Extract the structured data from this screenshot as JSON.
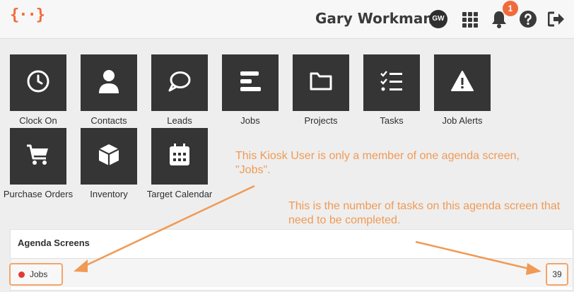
{
  "header": {
    "logo_text": "{··}",
    "user_name": "Gary Workman",
    "avatar_initials": "GW",
    "notification_count": "1",
    "icons": [
      "apps-grid-icon",
      "bell-icon",
      "help-icon",
      "logout-icon"
    ]
  },
  "tiles": [
    {
      "label": "Clock On",
      "icon": "clock-icon"
    },
    {
      "label": "Contacts",
      "icon": "user-icon"
    },
    {
      "label": "Leads",
      "icon": "speech-bubble-icon"
    },
    {
      "label": "Jobs",
      "icon": "bars-icon"
    },
    {
      "label": "Projects",
      "icon": "folder-icon"
    },
    {
      "label": "Tasks",
      "icon": "checklist-icon"
    },
    {
      "label": "Job Alerts",
      "icon": "warning-icon"
    },
    {
      "label": "Purchase Orders",
      "icon": "cart-icon"
    },
    {
      "label": "Inventory",
      "icon": "box-icon"
    },
    {
      "label": "Target Calendar",
      "icon": "calendar-icon"
    }
  ],
  "agenda": {
    "title": "Agenda Screens",
    "items": [
      {
        "name": "Jobs",
        "count": "39",
        "dot_color": "#e53935"
      }
    ]
  },
  "annotations": {
    "kiosk_note": "This Kiosk User is only a member of one agenda screen, \"Jobs\".",
    "tasks_note": "This is the number of tasks on this agenda screen that need to be completed."
  },
  "colors": {
    "accent": "#f06b3b",
    "annotation": "#f09a55",
    "tile_bg": "#353535"
  }
}
